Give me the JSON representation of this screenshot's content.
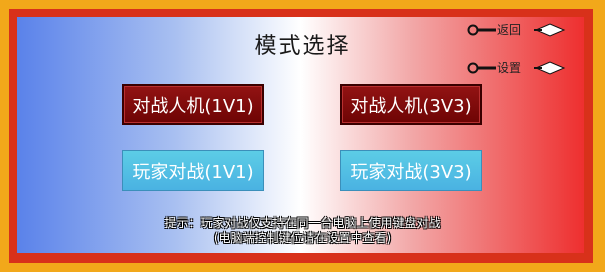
{
  "title": "模式选择",
  "nav": {
    "back_label": "返回",
    "settings_label": "设置"
  },
  "buttons": {
    "pve_1v1": "对战人机(1V1)",
    "pve_3v3": "对战人机(3V3)",
    "pvp_1v1": "玩家对战(1V1)",
    "pvp_3v3": "玩家对战(3V3)"
  },
  "hint": {
    "line1": "提示：玩家对战仅支持在同一台电脑上使用键盘对战",
    "line2": "(电脑端控制键位请在设置中查看)"
  },
  "colors": {
    "outer_frame": "#f2a81a",
    "inner_frame": "#d8311a",
    "gradient_left": "#5a82ea",
    "gradient_right": "#ee2f2f",
    "pve_button": "#7a0909",
    "pvp_button": "#4fc0e4"
  },
  "icons": {
    "nav": "kunai-icon"
  }
}
